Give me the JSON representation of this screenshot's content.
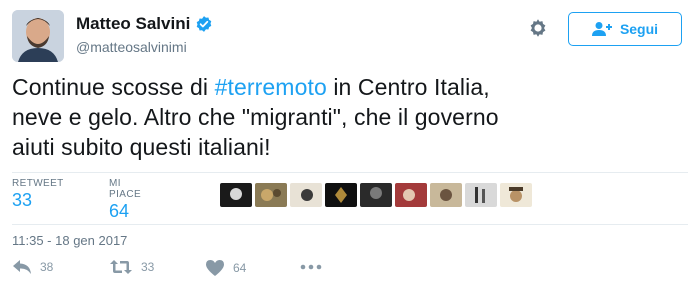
{
  "author": {
    "display_name": "Matteo Salvini",
    "handle": "@matteosalvinimi",
    "verified_icon": "verified-badge-icon"
  },
  "header": {
    "follow_label": "Segui",
    "settings_icon": "gear-icon",
    "follow_icon": "add-user-icon"
  },
  "tweet": {
    "line1_before": "Continue scosse di ",
    "hashtag": "#terremoto",
    "line1_after": " in Centro Italia,",
    "line2": "neve e gelo. Altro che \"migranti\", che il governo",
    "line3": "aiuti subito questi italiani!"
  },
  "stats": {
    "retweet_label": "RETWEET",
    "retweet_count": "33",
    "likes_label": "MI PIACE",
    "likes_count": "64"
  },
  "timestamp": "11:35 - 18 gen 2017",
  "actions": {
    "reply_count": "38",
    "retweet_count": "33",
    "like_count": "64"
  },
  "colors": {
    "accent": "#1da1f2",
    "muted": "#657786",
    "icon": "#8899a6"
  }
}
